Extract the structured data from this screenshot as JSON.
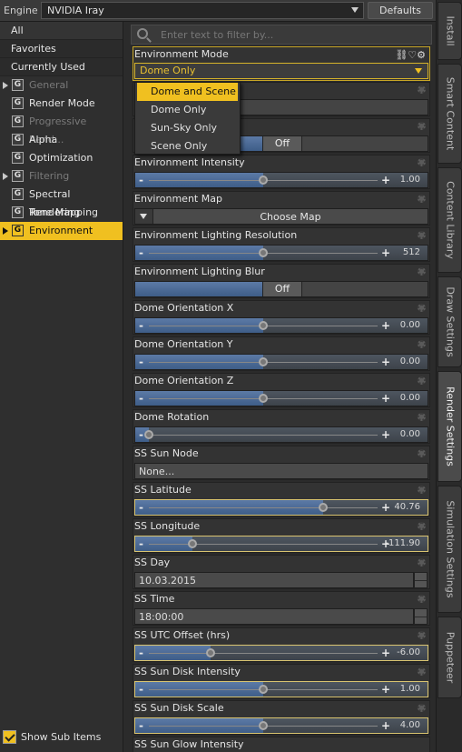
{
  "engine": {
    "label": "Engine :",
    "value": "NVIDIA Iray",
    "defaults_label": "Defaults"
  },
  "categories": [
    {
      "label": "All"
    },
    {
      "label": "Favorites"
    },
    {
      "label": "Currently Used"
    },
    {
      "label": "General",
      "dim": true,
      "arrow": true
    },
    {
      "label": "Render Mode"
    },
    {
      "label": "Progressive Rend...",
      "dim": true
    },
    {
      "label": "Alpha"
    },
    {
      "label": "Optimization"
    },
    {
      "label": "Filtering",
      "dim": true,
      "arrow": true
    },
    {
      "label": "Spectral Rendering"
    },
    {
      "label": "Tone Mapping"
    },
    {
      "label": "Environment",
      "active": true,
      "arrow": true
    }
  ],
  "show_sub_items": {
    "label": "Show Sub Items",
    "checked": true
  },
  "filter": {
    "placeholder": "Enter text to filter by..."
  },
  "env_mode": {
    "label": "Environment Mode",
    "value": "Dome Only",
    "icons": "⛓♡⚙"
  },
  "env_mode_options": [
    {
      "label": "Dome and Scene",
      "selected": true
    },
    {
      "label": "Dome Only"
    },
    {
      "label": "Sun-Sky Only"
    },
    {
      "label": "Scene Only"
    }
  ],
  "toggle_off": "Off",
  "choose_map": "Choose Map",
  "props": {
    "env_intensity": {
      "label": "Environment Intensity",
      "value": "1.00",
      "fraction": 0.5
    },
    "env_map": {
      "label": "Environment Map"
    },
    "env_light_res": {
      "label": "Environment Lighting Resolution",
      "value": "512",
      "fraction": 0.5
    },
    "env_light_blur": {
      "label": "Environment Lighting Blur"
    },
    "dome_x": {
      "label": "Dome Orientation X",
      "value": "0.00",
      "fraction": 0.5
    },
    "dome_y": {
      "label": "Dome Orientation Y",
      "value": "0.00",
      "fraction": 0.5
    },
    "dome_z": {
      "label": "Dome Orientation Z",
      "value": "0.00",
      "fraction": 0.5
    },
    "dome_rot": {
      "label": "Dome Rotation",
      "value": "0.00",
      "fraction": 0.0
    },
    "ss_sun_node": {
      "label": "SS Sun Node",
      "value": "None..."
    },
    "ss_latitude": {
      "label": "SS Latitude",
      "value": "40.76",
      "fraction": 0.76
    },
    "ss_longitude": {
      "label": "SS Longitude",
      "value": "-111.90",
      "fraction": 0.19
    },
    "ss_day": {
      "label": "SS Day",
      "value": "10.03.2015"
    },
    "ss_time": {
      "label": "SS Time",
      "value": "18:00:00"
    },
    "ss_utc": {
      "label": "SS UTC Offset (hrs)",
      "value": "-6.00",
      "fraction": 0.27
    },
    "ss_disk_int": {
      "label": "SS Sun Disk Intensity",
      "value": "1.00",
      "fraction": 0.5
    },
    "ss_disk_scale": {
      "label": "SS Sun Disk Scale",
      "value": "4.00",
      "fraction": 0.5
    },
    "ss_glow": {
      "label": "SS Sun Glow Intensity"
    }
  },
  "side_tabs": [
    {
      "label": "Install"
    },
    {
      "label": "Smart Content"
    },
    {
      "label": "Content Library"
    },
    {
      "label": "Draw Settings"
    },
    {
      "label": "Render Settings",
      "active": true
    },
    {
      "label": "Simulation Settings"
    },
    {
      "label": "Puppeteer"
    }
  ]
}
